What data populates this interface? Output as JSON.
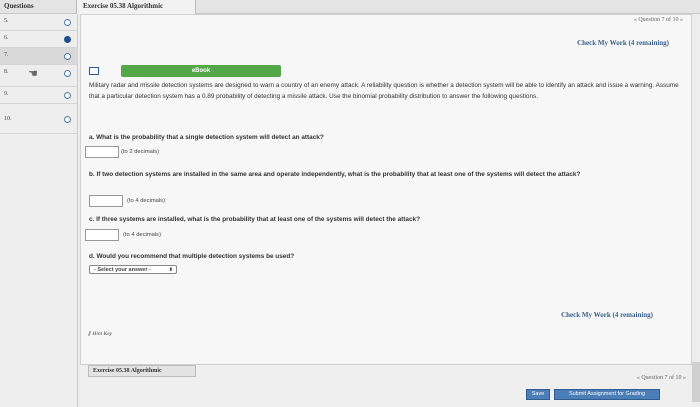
{
  "sidebar": {
    "header": "Questions",
    "items": [
      {
        "num": "5.",
        "state": "open",
        "active": false
      },
      {
        "num": "6.",
        "state": "filled",
        "active": false
      },
      {
        "num": "7.",
        "state": "open",
        "active": true
      },
      {
        "num": "8.",
        "state": "open",
        "active": false
      },
      {
        "num": "9.",
        "state": "open",
        "active": false
      },
      {
        "num": "10.",
        "state": "open",
        "active": false
      }
    ]
  },
  "tab": {
    "title": "Exercise 05.38 Algorithmic"
  },
  "nav": {
    "question_counter": "« Question 7 of 10 »"
  },
  "check_my_work": "Check My Work (4 remaining)",
  "ebook": {
    "label": "eBook"
  },
  "problem": {
    "intro": "Military radar and missile detection systems are designed to warn a country of an enemy attack. A reliability question is whether a detection system will be able to identify an attack and issue a warning. Assume that a particular detection system has a 0.89 probability of detecting a missile attack. Use the binomial probability distribution to answer the following questions.",
    "part_a": "a. What is the probability that a single detection system will detect an attack?",
    "hint_a": "(to 2 decimals)",
    "part_b": "b. If two detection systems are installed in the same area and operate independently, what is the probability that at least one of the systems will detect the attack?",
    "hint_b": "(to 4 decimals)",
    "part_c": "c. If three systems are installed, what is the probability that at least one of the systems will detect the attack?",
    "hint_c": "(to 4 decimals)",
    "part_d": "d. Would you recommend that multiple detection systems be used?",
    "select_placeholder": "- Select your answer -"
  },
  "hint_key": "Hint Key",
  "footer": {
    "tab_title": "Exercise 05.38 Algorithmic",
    "question_counter": "« Question 7 of 10 »",
    "save_label": "Save",
    "submit_label": "Submit Assignment for Grading"
  }
}
